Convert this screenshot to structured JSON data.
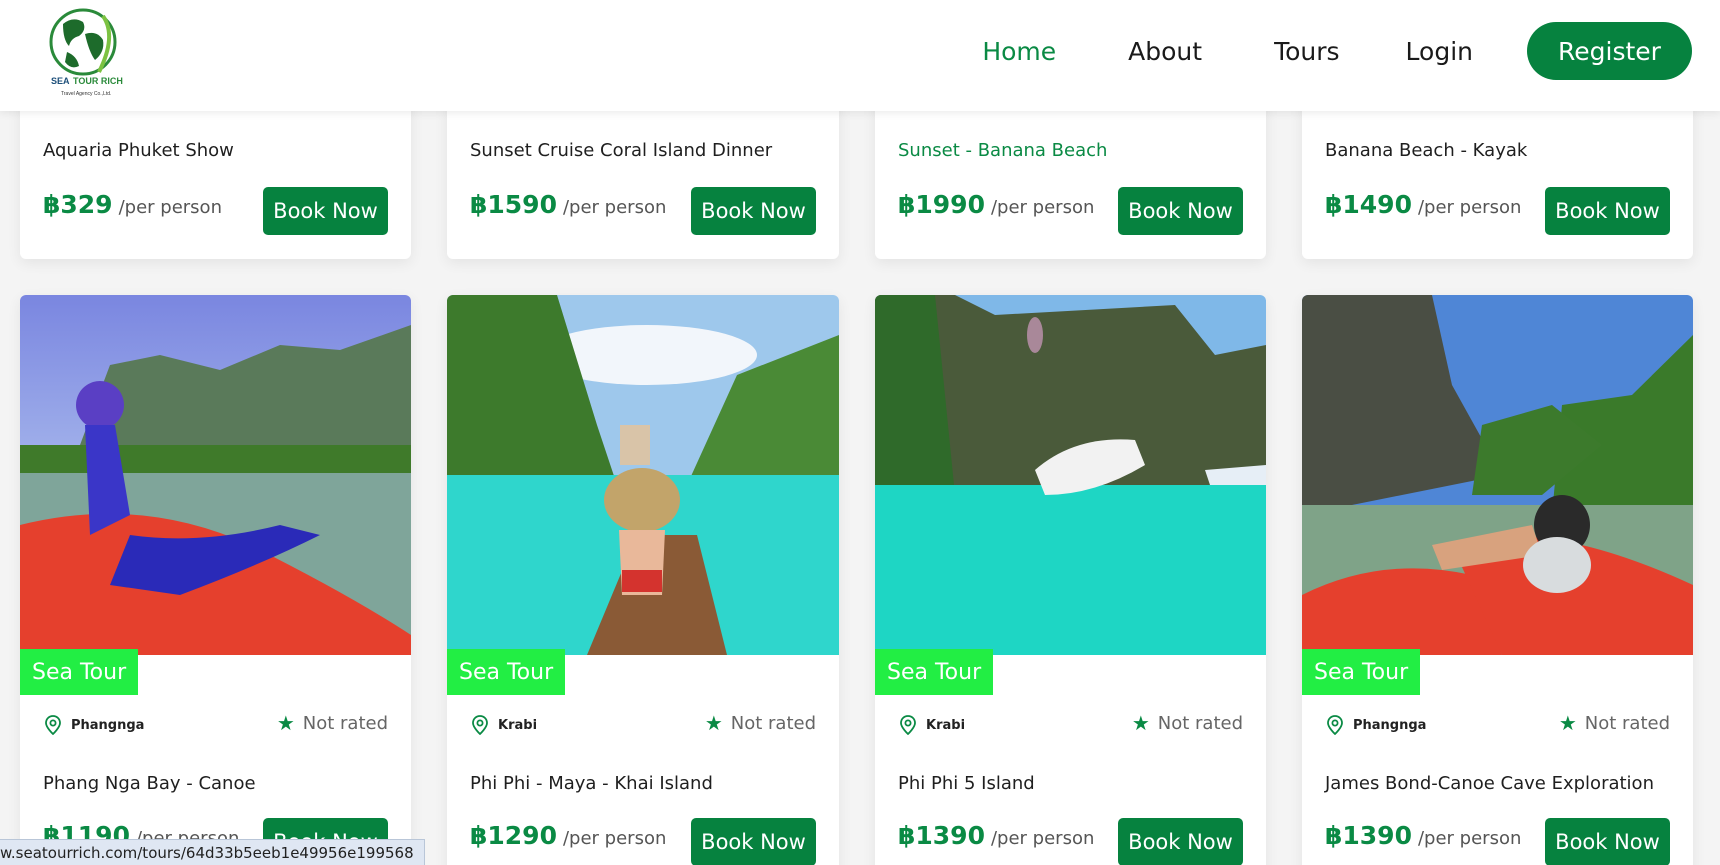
{
  "nav": {
    "logo_text": "SEA TOUR RICH",
    "logo_subtext": "Travel Agency Co.,Ltd.",
    "links": [
      "Home",
      "About",
      "Tours",
      "Login"
    ],
    "active": "Home",
    "register": "Register"
  },
  "currency": "฿",
  "per_label": "/per person",
  "book_label": "Book Now",
  "top_cards": [
    {
      "title": "Aquaria Phuket Show",
      "price": "฿329"
    },
    {
      "title": "Sunset Cruise Coral Island Dinner",
      "price": "฿1590"
    },
    {
      "title": "Sunset - Banana Beach",
      "price": "฿1990",
      "highlight": true
    },
    {
      "title": "Banana Beach - Kayak",
      "price": "฿1490"
    }
  ],
  "bottom_cards": [
    {
      "badge": "Sea Tour",
      "location": "Phangnga",
      "rating": "Not rated",
      "title": "Phang Nga Bay - Canoe",
      "price": "฿1190"
    },
    {
      "badge": "Sea Tour",
      "location": "Krabi",
      "rating": "Not rated",
      "title": "Phi Phi - Maya - Khai Island",
      "price": "฿1290"
    },
    {
      "badge": "Sea Tour",
      "location": "Krabi",
      "rating": "Not rated",
      "title": "Phi Phi 5 Island",
      "price": "฿1390"
    },
    {
      "badge": "Sea Tour",
      "location": "Phangnga",
      "rating": "Not rated",
      "title": "James Bond-Canoe Cave Exploration",
      "price": "฿1390"
    }
  ],
  "status_url": "w.seatourrich.com/tours/64d33b5eeb1e49956e199568",
  "colors": {
    "brand": "#06823f",
    "badge": "#22ee44"
  }
}
